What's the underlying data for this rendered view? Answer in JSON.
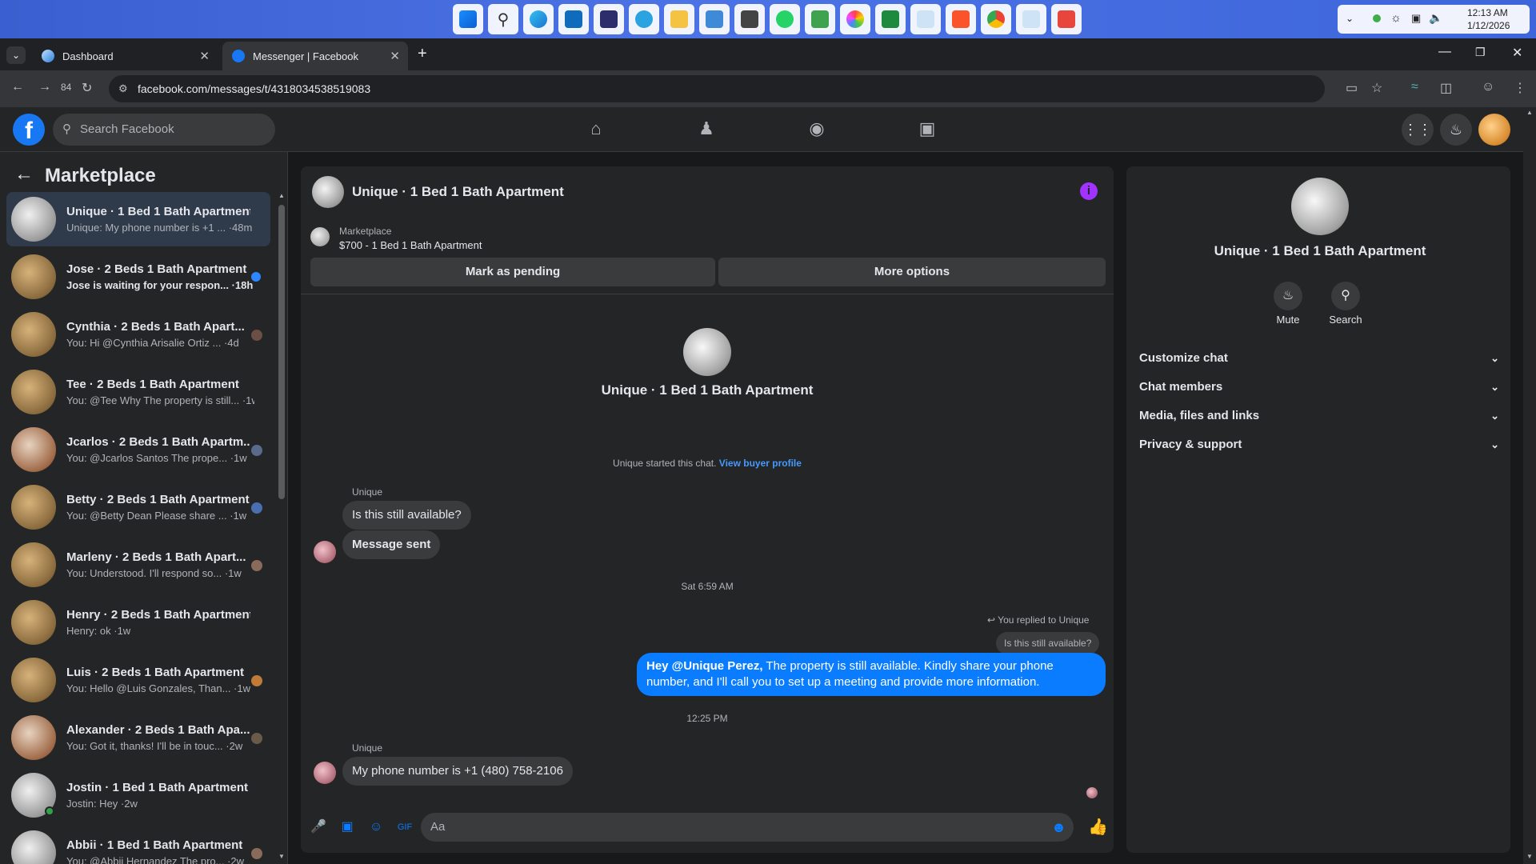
{
  "taskbar": {
    "time": "12:13 AM",
    "date": "1/12/2026"
  },
  "browser": {
    "tabs": [
      {
        "label": "Dashboard"
      },
      {
        "label": "Messenger | Facebook"
      }
    ],
    "url": "facebook.com/messages/t/4318034538519083",
    "extension_badge": "84"
  },
  "fb": {
    "search_placeholder": "Search Facebook"
  },
  "left": {
    "title": "Marketplace",
    "conversations": [
      {
        "name": "Unique · 1 Bed 1 Bath Apartment",
        "preview": "Unique: My phone number is +1 ... ·48m"
      },
      {
        "name": "Jose · 2 Beds 1 Bath Apartment",
        "preview": "Jose is waiting for your respon... ·18h"
      },
      {
        "name": "Cynthia · 2 Beds 1 Bath Apart...",
        "preview": "You: Hi @Cynthia Arisalie Ortiz ... ·4d"
      },
      {
        "name": "Tee · 2 Beds 1 Bath Apartment",
        "preview": "You: @Tee Why The property is still... ·1w"
      },
      {
        "name": "Jcarlos · 2 Beds 1 Bath Apartm...",
        "preview": "You: @Jcarlos Santos The prope... ·1w"
      },
      {
        "name": "Betty · 2 Beds 1 Bath Apartment",
        "preview": "You: @Betty Dean Please share ... ·1w"
      },
      {
        "name": "Marleny · 2 Beds 1 Bath Apart...",
        "preview": "You: Understood. I'll respond so... ·1w"
      },
      {
        "name": "Henry · 2 Beds 1 Bath Apartment",
        "preview": "Henry: ok ·1w"
      },
      {
        "name": "Luis · 2 Beds 1 Bath Apartment",
        "preview": "You: Hello @Luis Gonzales, Than... ·1w"
      },
      {
        "name": "Alexander · 2 Beds 1 Bath Apa...",
        "preview": "You: Got it, thanks! I'll be in touc... ·2w"
      },
      {
        "name": "Jostin · 1 Bed 1 Bath Apartment",
        "preview": "Jostin: Hey ·2w"
      },
      {
        "name": "Abbii · 1 Bed 1 Bath Apartment",
        "preview": "You: @Abbii Hernandez The pro... ·2w"
      }
    ]
  },
  "chat": {
    "title": "Unique · 1 Bed 1 Bath Apartment",
    "listing_label": "Marketplace",
    "listing_price": "$700 - 1 Bed 1 Bath Apartment",
    "mark_pending": "Mark as pending",
    "more_options": "More options",
    "center_title": "Unique · 1 Bed 1 Bath Apartment",
    "started_text": "Unique started this chat.",
    "view_buyer": "View buyer profile",
    "sender1": "Unique",
    "msg1": "Is this still available?",
    "msg2": "Message sent",
    "time1": "Sat 6:59 AM",
    "replied_to": "You replied to Unique",
    "reply_quote": "Is this still available?",
    "out_mention": "Hey @Unique Perez,",
    "out_text": " The property is still available. Kindly share your phone number, and I'll call you to set up a meeting and provide more information.",
    "time2": "12:25 PM",
    "sender2": "Unique",
    "msg3": "My phone number is +1 (480) 758-2106",
    "composer_placeholder": "Aa"
  },
  "right": {
    "title": "Unique · 1 Bed 1 Bath Apartment",
    "mute": "Mute",
    "search": "Search",
    "sections": [
      "Customize chat",
      "Chat members",
      "Media, files and links",
      "Privacy & support"
    ]
  }
}
